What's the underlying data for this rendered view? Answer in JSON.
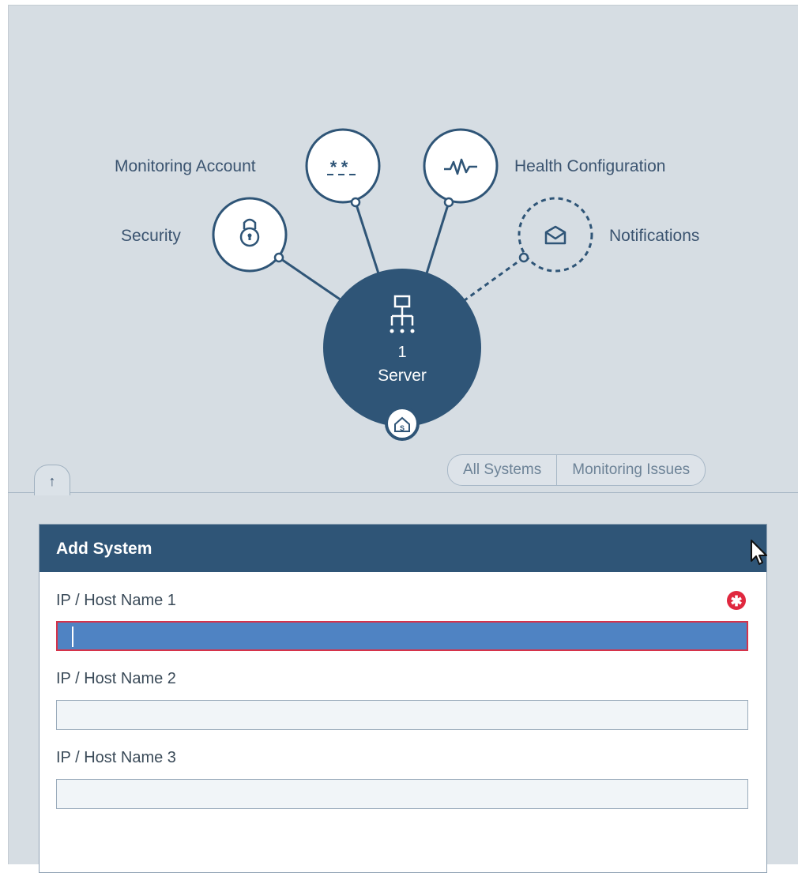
{
  "diagram": {
    "hub": {
      "count": "1",
      "label": "Server"
    },
    "nodes": {
      "monitoring_account": {
        "label": "Monitoring Account",
        "icon": "password-icon"
      },
      "health_configuration": {
        "label": "Health Configuration",
        "icon": "heartbeat-icon"
      },
      "security": {
        "label": "Security",
        "icon": "lock-icon"
      },
      "notifications": {
        "label": "Notifications",
        "icon": "envelope-icon",
        "state": "not-configured"
      }
    }
  },
  "toolbar": {
    "collapse_icon": "↑",
    "filters": [
      {
        "label": "All Systems"
      },
      {
        "label": "Monitoring Issues"
      }
    ]
  },
  "add_system": {
    "title": "Add System",
    "required_icon": "✱",
    "fields": [
      {
        "label": "IP / Host Name 1",
        "value": "",
        "required": true,
        "focused": true
      },
      {
        "label": "IP / Host Name 2",
        "value": ""
      },
      {
        "label": "IP / Host Name 3",
        "value": ""
      }
    ]
  },
  "colors": {
    "primary": "#2f5577",
    "background": "#d6dde3",
    "input_focus": "#4f83c3",
    "error": "#e0283f"
  }
}
